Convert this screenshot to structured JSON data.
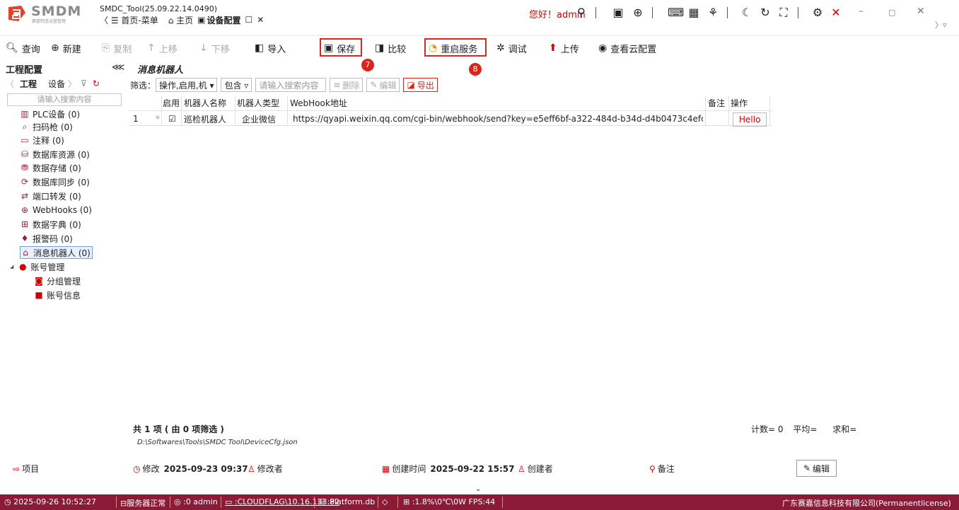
{
  "app": {
    "logo_text": "SMDM",
    "logo_sub": "赛盟制造运营管理",
    "title": "SMDC_Tool(25.09.22.14.0490)",
    "greeting": "您好！admin",
    "breadcrumb_home": "〈 ☰ 首页-菜单",
    "tab_main": "⌂ 主页",
    "tab_active": "设备配置",
    "tab_more": "〉 ▿"
  },
  "toolbar": {
    "query": "查询",
    "new": "新建",
    "copy": "复制",
    "move_up": "上移",
    "move_down": "下移",
    "import": "导入",
    "save": "保存",
    "compare": "比较",
    "restart": "重启服务",
    "debug": "调试",
    "upload": "上传",
    "view_cloud": "查看云配置",
    "badge_save": "7",
    "badge_restart": "8"
  },
  "left": {
    "header": "工程配置",
    "tab_project": "工程",
    "tab_device": "设备",
    "search_placeholder": "请输入搜索内容",
    "items": [
      {
        "label": "PLC设备 (0)",
        "icon": "▥"
      },
      {
        "label": "扫码枪 (0)",
        "icon": "⌕"
      },
      {
        "label": "注释 (0)",
        "icon": "▭"
      },
      {
        "label": "数据库资源 (0)",
        "icon": "⛁"
      },
      {
        "label": "数据存储 (0)",
        "icon": "⛃"
      },
      {
        "label": "数据库同步 (0)",
        "icon": "⟳"
      },
      {
        "label": "端口转发 (0)",
        "icon": "⇄"
      },
      {
        "label": "WebHooks (0)",
        "icon": "⊕"
      },
      {
        "label": "数据字典 (0)",
        "icon": "⊞"
      },
      {
        "label": "报警码 (0)",
        "icon": "♦"
      },
      {
        "label": "消息机器人 (0)",
        "icon": "⌂"
      },
      {
        "label": "账号管理",
        "icon": "●"
      },
      {
        "label": "分组管理",
        "icon": "◙"
      },
      {
        "label": "账号信息",
        "icon": "■"
      }
    ]
  },
  "main": {
    "title": "消息机器人",
    "filter_label": "筛选：",
    "filter_value": "操作,启用,机 ▾",
    "filter_op": "包含 ▿",
    "search_placeholder": "请输入搜索内容",
    "delete": "删除",
    "edit": "编辑",
    "export": "导出",
    "columns": [
      "启用",
      "机器人名称",
      "机器人类型",
      "WebHook地址",
      "备注",
      "操作"
    ],
    "rows": [
      {
        "index": "1",
        "marker": "*",
        "enabled": "☑",
        "name": "巡检机器人",
        "type": "企业微信",
        "url": "https://qyapi.weixin.qq.com/cgi-bin/webhook/send?key=e5eff6bf-a322-484d-b34d-d4b0473c4efc",
        "note": "",
        "action": "Hello"
      }
    ],
    "summary": "共 1 项 ( 由 0 项筛选 )",
    "count": "计数= 0",
    "avg": "平均=",
    "sum": "求和=",
    "path": "D:\\Softwares\\Tools\\SMDC Tool\\DeviceCfg.json"
  },
  "info": {
    "project": "项目",
    "modified": "修改",
    "modified_time": "2025-09-23 09:37",
    "modifier": "修改者",
    "created": "创建时间",
    "created_time": "2025-09-22 15:57",
    "creator": "创建者",
    "note": "备注",
    "edit": "编辑"
  },
  "status": {
    "time": "2025-09-26 10:52:27",
    "server": "服务器正常",
    "user": ":0 admin",
    "host": ":CLOUDFLAG\\10.16.133.82",
    "db": ":Platform.db",
    "cpu": ":1.8%\\0℃\\0W  FPS:44",
    "company": "广东赛嘉信息科技有限公司(Permanentlicense)"
  }
}
